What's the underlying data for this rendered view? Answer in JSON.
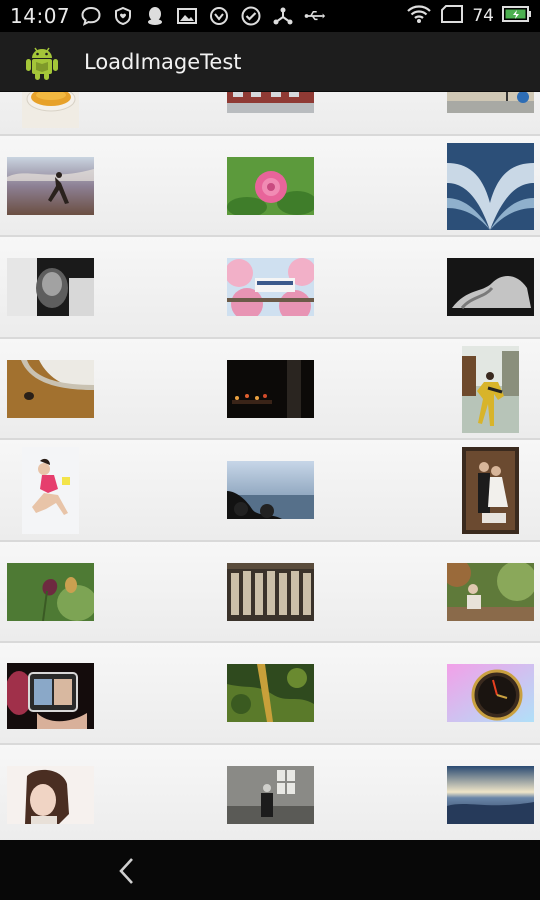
{
  "status_bar": {
    "time": "14:07",
    "battery_level": "74",
    "icons_left": [
      "chat-bubble-icon",
      "shield-heart-icon",
      "qq-penguin-icon",
      "image-icon",
      "sync-icon",
      "check-circle-icon",
      "share-hub-icon",
      "usb-icon"
    ],
    "icons_right": [
      "wifi-icon",
      "sim-card-icon",
      "battery-icon"
    ],
    "battery_color": "#4caf50"
  },
  "action_bar": {
    "title": "LoadImageTest",
    "icon": "android-robot-icon"
  },
  "grid": {
    "rows": [
      [
        "tea-cup",
        "red-building",
        "road-sign"
      ],
      [
        "dancer-sky",
        "pink-peony",
        "blue-abstract"
      ],
      [
        "bw-portrait",
        "cherry-blossom-train",
        "bw-figure"
      ],
      [
        "turtle-beach",
        "dark-stage",
        "dancing-couple"
      ],
      [
        "girl-pink",
        "motorbike-sea",
        "couple-portrait"
      ],
      [
        "lotus-pod",
        "statues-bw",
        "person-garden"
      ],
      [
        "photo-frame-hand",
        "green-aerial",
        "pocket-watch"
      ],
      [
        "girl-smile",
        "old-man-room",
        "sunset-sea"
      ]
    ]
  },
  "nav_bar": {
    "back_icon": "chevron-left-icon"
  }
}
